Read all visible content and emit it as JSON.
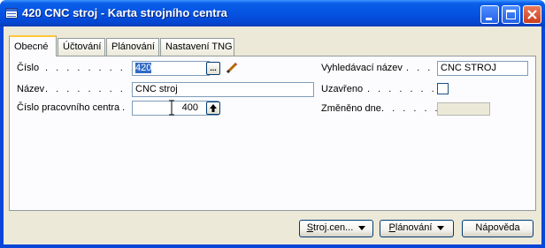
{
  "window": {
    "title": "420 CNC stroj - Karta strojního centra"
  },
  "tabs": [
    {
      "label": "Obecné",
      "active": true
    },
    {
      "label": "Účtování",
      "active": false
    },
    {
      "label": "Plánování",
      "active": false
    },
    {
      "label": "Nastavení TNG",
      "active": false
    }
  ],
  "form": {
    "cislo": {
      "label": "Číslo",
      "dots": ". . . . . . . . . .",
      "value": "420"
    },
    "nazev": {
      "label": "Název",
      "dots": ". . . . . . . . . .",
      "value": "CNC stroj"
    },
    "cislo_pc": {
      "label": "Číslo pracovního centra",
      "dots": ".",
      "value": "400"
    },
    "vyhledavaci": {
      "label": "Vyhledávací název",
      "dots": ". . . .",
      "value": "CNC STROJ"
    },
    "uzavreno": {
      "label": "Uzavřeno",
      "dots": ". . . . . . . .",
      "checked": false
    },
    "zmeneno": {
      "label": "Změněno dne",
      "dots": ". . . . . .",
      "value": ""
    }
  },
  "buttons": {
    "stroj": {
      "label_u": "S",
      "label_rest": "troj.cen..."
    },
    "planovani": {
      "label_u": "P",
      "label_rest": "lánování"
    },
    "napoveda": {
      "label": "Nápověda"
    }
  },
  "icons": {
    "lookup": "...",
    "edit": "pencil-icon",
    "drilldown": "up-arrow-icon"
  }
}
